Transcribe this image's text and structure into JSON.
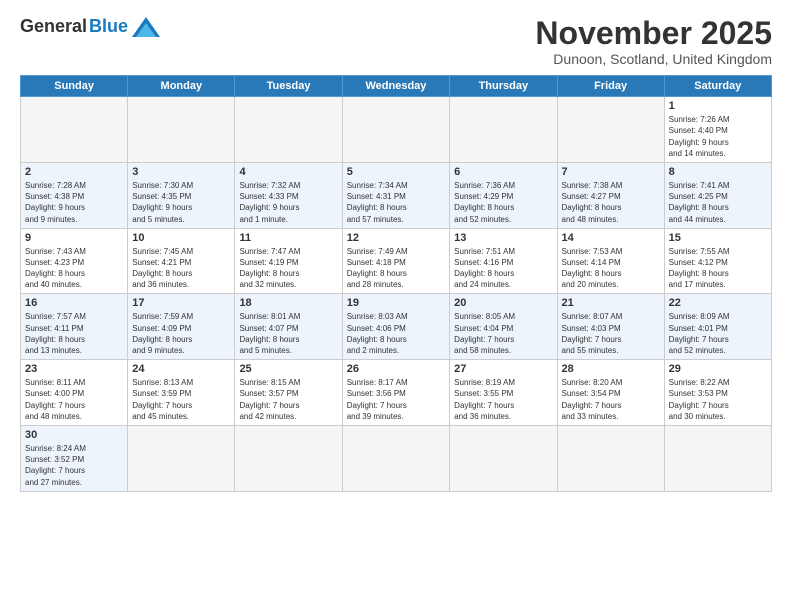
{
  "header": {
    "logo_general": "General",
    "logo_blue": "Blue",
    "month_title": "November 2025",
    "subtitle": "Dunoon, Scotland, United Kingdom"
  },
  "days_of_week": [
    "Sunday",
    "Monday",
    "Tuesday",
    "Wednesday",
    "Thursday",
    "Friday",
    "Saturday"
  ],
  "weeks": [
    {
      "row_class": "week-row-1",
      "days": [
        {
          "num": "",
          "info": "",
          "empty": true
        },
        {
          "num": "",
          "info": "",
          "empty": true
        },
        {
          "num": "",
          "info": "",
          "empty": true
        },
        {
          "num": "",
          "info": "",
          "empty": true
        },
        {
          "num": "",
          "info": "",
          "empty": true
        },
        {
          "num": "",
          "info": "",
          "empty": true
        },
        {
          "num": "1",
          "info": "Sunrise: 7:26 AM\nSunset: 4:40 PM\nDaylight: 9 hours\nand 14 minutes.",
          "empty": false
        }
      ]
    },
    {
      "row_class": "week-row-2",
      "days": [
        {
          "num": "2",
          "info": "Sunrise: 7:28 AM\nSunset: 4:38 PM\nDaylight: 9 hours\nand 9 minutes.",
          "empty": false
        },
        {
          "num": "3",
          "info": "Sunrise: 7:30 AM\nSunset: 4:35 PM\nDaylight: 9 hours\nand 5 minutes.",
          "empty": false
        },
        {
          "num": "4",
          "info": "Sunrise: 7:32 AM\nSunset: 4:33 PM\nDaylight: 9 hours\nand 1 minute.",
          "empty": false
        },
        {
          "num": "5",
          "info": "Sunrise: 7:34 AM\nSunset: 4:31 PM\nDaylight: 8 hours\nand 57 minutes.",
          "empty": false
        },
        {
          "num": "6",
          "info": "Sunrise: 7:36 AM\nSunset: 4:29 PM\nDaylight: 8 hours\nand 52 minutes.",
          "empty": false
        },
        {
          "num": "7",
          "info": "Sunrise: 7:38 AM\nSunset: 4:27 PM\nDaylight: 8 hours\nand 48 minutes.",
          "empty": false
        },
        {
          "num": "8",
          "info": "Sunrise: 7:41 AM\nSunset: 4:25 PM\nDaylight: 8 hours\nand 44 minutes.",
          "empty": false
        }
      ]
    },
    {
      "row_class": "week-row-3",
      "days": [
        {
          "num": "9",
          "info": "Sunrise: 7:43 AM\nSunset: 4:23 PM\nDaylight: 8 hours\nand 40 minutes.",
          "empty": false
        },
        {
          "num": "10",
          "info": "Sunrise: 7:45 AM\nSunset: 4:21 PM\nDaylight: 8 hours\nand 36 minutes.",
          "empty": false
        },
        {
          "num": "11",
          "info": "Sunrise: 7:47 AM\nSunset: 4:19 PM\nDaylight: 8 hours\nand 32 minutes.",
          "empty": false
        },
        {
          "num": "12",
          "info": "Sunrise: 7:49 AM\nSunset: 4:18 PM\nDaylight: 8 hours\nand 28 minutes.",
          "empty": false
        },
        {
          "num": "13",
          "info": "Sunrise: 7:51 AM\nSunset: 4:16 PM\nDaylight: 8 hours\nand 24 minutes.",
          "empty": false
        },
        {
          "num": "14",
          "info": "Sunrise: 7:53 AM\nSunset: 4:14 PM\nDaylight: 8 hours\nand 20 minutes.",
          "empty": false
        },
        {
          "num": "15",
          "info": "Sunrise: 7:55 AM\nSunset: 4:12 PM\nDaylight: 8 hours\nand 17 minutes.",
          "empty": false
        }
      ]
    },
    {
      "row_class": "week-row-4",
      "days": [
        {
          "num": "16",
          "info": "Sunrise: 7:57 AM\nSunset: 4:11 PM\nDaylight: 8 hours\nand 13 minutes.",
          "empty": false
        },
        {
          "num": "17",
          "info": "Sunrise: 7:59 AM\nSunset: 4:09 PM\nDaylight: 8 hours\nand 9 minutes.",
          "empty": false
        },
        {
          "num": "18",
          "info": "Sunrise: 8:01 AM\nSunset: 4:07 PM\nDaylight: 8 hours\nand 5 minutes.",
          "empty": false
        },
        {
          "num": "19",
          "info": "Sunrise: 8:03 AM\nSunset: 4:06 PM\nDaylight: 8 hours\nand 2 minutes.",
          "empty": false
        },
        {
          "num": "20",
          "info": "Sunrise: 8:05 AM\nSunset: 4:04 PM\nDaylight: 7 hours\nand 58 minutes.",
          "empty": false
        },
        {
          "num": "21",
          "info": "Sunrise: 8:07 AM\nSunset: 4:03 PM\nDaylight: 7 hours\nand 55 minutes.",
          "empty": false
        },
        {
          "num": "22",
          "info": "Sunrise: 8:09 AM\nSunset: 4:01 PM\nDaylight: 7 hours\nand 52 minutes.",
          "empty": false
        }
      ]
    },
    {
      "row_class": "week-row-5",
      "days": [
        {
          "num": "23",
          "info": "Sunrise: 8:11 AM\nSunset: 4:00 PM\nDaylight: 7 hours\nand 48 minutes.",
          "empty": false
        },
        {
          "num": "24",
          "info": "Sunrise: 8:13 AM\nSunset: 3:59 PM\nDaylight: 7 hours\nand 45 minutes.",
          "empty": false
        },
        {
          "num": "25",
          "info": "Sunrise: 8:15 AM\nSunset: 3:57 PM\nDaylight: 7 hours\nand 42 minutes.",
          "empty": false
        },
        {
          "num": "26",
          "info": "Sunrise: 8:17 AM\nSunset: 3:56 PM\nDaylight: 7 hours\nand 39 minutes.",
          "empty": false
        },
        {
          "num": "27",
          "info": "Sunrise: 8:19 AM\nSunset: 3:55 PM\nDaylight: 7 hours\nand 36 minutes.",
          "empty": false
        },
        {
          "num": "28",
          "info": "Sunrise: 8:20 AM\nSunset: 3:54 PM\nDaylight: 7 hours\nand 33 minutes.",
          "empty": false
        },
        {
          "num": "29",
          "info": "Sunrise: 8:22 AM\nSunset: 3:53 PM\nDaylight: 7 hours\nand 30 minutes.",
          "empty": false
        }
      ]
    },
    {
      "row_class": "week-row-6",
      "days": [
        {
          "num": "30",
          "info": "Sunrise: 8:24 AM\nSunset: 3:52 PM\nDaylight: 7 hours\nand 27 minutes.",
          "empty": false
        },
        {
          "num": "",
          "info": "",
          "empty": true
        },
        {
          "num": "",
          "info": "",
          "empty": true
        },
        {
          "num": "",
          "info": "",
          "empty": true
        },
        {
          "num": "",
          "info": "",
          "empty": true
        },
        {
          "num": "",
          "info": "",
          "empty": true
        },
        {
          "num": "",
          "info": "",
          "empty": true
        }
      ]
    }
  ]
}
